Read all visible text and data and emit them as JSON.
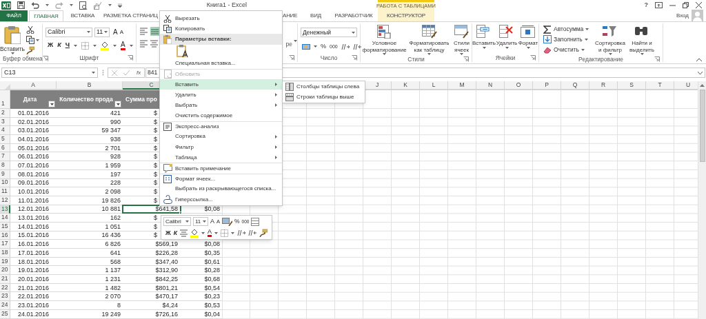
{
  "title_bar": {
    "title": "Книга1 - Excel",
    "help": "?",
    "contextual_group": "РАБОТА С ТАБЛИЦАМИ",
    "sign_in": "Вход"
  },
  "tabs": [
    {
      "label": "ФАЙЛ",
      "kind": "file",
      "selected": false
    },
    {
      "label": "ГЛАВНАЯ",
      "kind": "tab",
      "selected": true
    },
    {
      "label": "ВСТАВКА",
      "kind": "tab",
      "selected": false
    },
    {
      "label": "РАЗМЕТКА СТРАНИЦ",
      "kind": "tab",
      "selected": false
    },
    {
      "label": "АНИЕ",
      "kind": "tab",
      "selected": false
    },
    {
      "label": "ВИД",
      "kind": "tab",
      "selected": false
    },
    {
      "label": "РАЗРАБОТЧИК",
      "kind": "tab",
      "selected": false
    },
    {
      "label": "КОНСТРУКТОР",
      "kind": "contextual",
      "selected": false
    }
  ],
  "ribbon": {
    "groups": [
      {
        "kind": "clipboard",
        "label": "Буфер обмена",
        "paste": "Вставить"
      },
      {
        "kind": "font",
        "label": "Шрифт",
        "font": "Calibri",
        "size": "11",
        "grow": "A",
        "shrink": "A",
        "styles": [
          "Ж",
          "К",
          "Ч"
        ],
        "font_color": "A"
      },
      {
        "kind": "alignment",
        "fragment": "ре",
        "align_buttons": [
          {
            "selected": false
          },
          {
            "selected": true
          }
        ]
      },
      {
        "kind": "number",
        "label": "Число",
        "format": "Денежный",
        "percent": "%",
        "thousands": "000"
      },
      {
        "kind": "styles",
        "label": "Стили",
        "buttons": [
          {
            "label": "Условное форматирование"
          },
          {
            "label": "Форматировать как таблицу"
          },
          {
            "label": "Стили ячеек"
          }
        ]
      },
      {
        "kind": "cells",
        "label": "Ячейки",
        "buttons": [
          {
            "label": "Вставить"
          },
          {
            "label": "Удалить"
          },
          {
            "label": "Формат"
          }
        ]
      },
      {
        "kind": "editing",
        "label": "Редактирование",
        "small_buttons": [
          {
            "label": "Автосумма"
          },
          {
            "label": "Заполнить"
          },
          {
            "label": "Очистить"
          }
        ],
        "buttons": [
          {
            "label": "Сортировка и фильтр"
          },
          {
            "label": "Найти и выделить"
          }
        ]
      }
    ]
  },
  "formula_bar": {
    "name_box": "C13",
    "fx": "fx",
    "value": "841"
  },
  "sheet": {
    "column_headers": [
      {
        "label": "A",
        "selected": false
      },
      {
        "label": "B",
        "selected": false
      },
      {
        "label": "C",
        "selected": true
      },
      {
        "label": "J",
        "selected": false
      },
      {
        "label": "K",
        "selected": false
      },
      {
        "label": "L",
        "selected": false
      },
      {
        "label": "M",
        "selected": false
      },
      {
        "label": "N",
        "selected": false
      },
      {
        "label": "O",
        "selected": false
      },
      {
        "label": "P",
        "selected": false
      },
      {
        "label": "Q",
        "selected": false
      },
      {
        "label": "R",
        "selected": false
      },
      {
        "label": "S",
        "selected": false
      },
      {
        "label": "T",
        "selected": false
      },
      {
        "label": "U",
        "selected": false
      }
    ],
    "header_row": {
      "n": "1",
      "cells": [
        {
          "label": "Дата",
          "filter": true
        },
        {
          "label": "Количество прода",
          "filter": true
        },
        {
          "label": "Сумма про",
          "filter": false
        }
      ]
    },
    "rows": [
      {
        "n": "2",
        "selected": false,
        "date": "01.01.2016",
        "qty": "421",
        "sum": "$",
        "sum_cut": true
      },
      {
        "n": "3",
        "selected": false,
        "date": "02.01.2016",
        "qty": "990",
        "sum": "$",
        "sum_cut": true
      },
      {
        "n": "4",
        "selected": false,
        "date": "03.01.2016",
        "qty": "59 347",
        "sum": "$",
        "sum_cut": true
      },
      {
        "n": "5",
        "selected": false,
        "date": "04.01.2016",
        "qty": "938",
        "sum": "$",
        "sum_cut": true
      },
      {
        "n": "6",
        "selected": false,
        "date": "05.01.2016",
        "qty": "2 701",
        "sum": "$",
        "sum_cut": true
      },
      {
        "n": "7",
        "selected": false,
        "date": "06.01.2016",
        "qty": "928",
        "sum": "$",
        "sum_cut": true
      },
      {
        "n": "8",
        "selected": false,
        "date": "07.01.2016",
        "qty": "1 959",
        "sum": "$",
        "sum_cut": true
      },
      {
        "n": "9",
        "selected": false,
        "date": "08.01.2016",
        "qty": "197",
        "sum": "$",
        "sum_cut": true
      },
      {
        "n": "10",
        "selected": false,
        "date": "09.01.2016",
        "qty": "228",
        "sum": "$",
        "sum_cut": true
      },
      {
        "n": "11",
        "selected": false,
        "date": "10.01.2016",
        "qty": "2 098",
        "sum": "$",
        "sum_cut": true
      },
      {
        "n": "12",
        "selected": false,
        "date": "11.01.2016",
        "qty": "19 826",
        "sum": "$",
        "sum_cut": true
      },
      {
        "n": "13",
        "selected": true,
        "date": "12.01.2016",
        "qty": "10 881",
        "sum": "$641,58",
        "sum_cut": false,
        "share": "$0,08"
      },
      {
        "n": "14",
        "selected": false,
        "date": "13.01.2016",
        "qty": "162",
        "sum": "$",
        "sum_cut": true
      },
      {
        "n": "15",
        "selected": false,
        "date": "14.01.2016",
        "qty": "1 051",
        "sum": "$",
        "sum_cut": true
      },
      {
        "n": "16",
        "selected": false,
        "date": "15.01.2016",
        "qty": "16 436",
        "sum": "$",
        "sum_cut": true
      },
      {
        "n": "17",
        "selected": false,
        "date": "16.01.2016",
        "qty": "6 826",
        "sum": "$569,19",
        "sum_cut": false,
        "share": "$0,08"
      },
      {
        "n": "18",
        "selected": false,
        "date": "17.01.2016",
        "qty": "641",
        "sum": "$226,28",
        "sum_cut": false,
        "share": "$0,35"
      },
      {
        "n": "19",
        "selected": false,
        "date": "18.01.2016",
        "qty": "568",
        "sum": "$347,40",
        "sum_cut": false,
        "share": "$0,61"
      },
      {
        "n": "20",
        "selected": false,
        "date": "19.01.2016",
        "qty": "1 137",
        "sum": "$312,90",
        "sum_cut": false,
        "share": "$0,28"
      },
      {
        "n": "21",
        "selected": false,
        "date": "20.01.2016",
        "qty": "1 231",
        "sum": "$842,25",
        "sum_cut": false,
        "share": "$0,68"
      },
      {
        "n": "22",
        "selected": false,
        "date": "21.01.2016",
        "qty": "1 482",
        "sum": "$801,21",
        "sum_cut": false,
        "share": "$0,54"
      },
      {
        "n": "23",
        "selected": false,
        "date": "22.01.2016",
        "qty": "2 070",
        "sum": "$470,17",
        "sum_cut": false,
        "share": "$0,23"
      },
      {
        "n": "24",
        "selected": false,
        "date": "23.01.2016",
        "qty": "8",
        "sum": "$4,24",
        "sum_cut": false,
        "share": "$0,53"
      },
      {
        "n": "25",
        "selected": false,
        "date": "24.01.2016",
        "qty": "19 249",
        "sum": "$726,16",
        "sum_cut": false,
        "share": "$0,04"
      }
    ]
  },
  "context_menu": {
    "items": [
      {
        "kind": "item",
        "label": "Вырезать",
        "disabled": false,
        "selected": false,
        "submenu": false,
        "separator_before": false
      },
      {
        "kind": "item",
        "label": "Копировать",
        "disabled": false,
        "selected": false,
        "submenu": false,
        "separator_before": false
      },
      {
        "kind": "header",
        "label": "Параметры вставки:"
      },
      {
        "kind": "paste-options"
      },
      {
        "kind": "item",
        "label": "Специальная вставка...",
        "disabled": false,
        "selected": false,
        "submenu": false,
        "separator_before": false
      },
      {
        "kind": "item",
        "label": "Обновить",
        "disabled": true,
        "selected": false,
        "submenu": false,
        "separator_before": true
      },
      {
        "kind": "item",
        "label": "Вставить",
        "disabled": false,
        "selected": true,
        "submenu": true,
        "separator_before": false
      },
      {
        "kind": "item",
        "label": "Удалить",
        "disabled": false,
        "selected": false,
        "submenu": true,
        "separator_before": false
      },
      {
        "kind": "item",
        "label": "Выбрать",
        "disabled": false,
        "selected": false,
        "submenu": true,
        "separator_before": false
      },
      {
        "kind": "item",
        "label": "Очистить содержимое",
        "disabled": false,
        "selected": false,
        "submenu": false,
        "separator_before": false
      },
      {
        "kind": "item",
        "label": "Экспресс-анализ",
        "disabled": false,
        "selected": false,
        "submenu": false,
        "separator_before": true
      },
      {
        "kind": "item",
        "label": "Сортировка",
        "disabled": false,
        "selected": false,
        "submenu": true,
        "separator_before": false
      },
      {
        "kind": "item",
        "label": "Фильтр",
        "disabled": false,
        "selected": false,
        "submenu": true,
        "separator_before": false
      },
      {
        "kind": "item",
        "label": "Таблица",
        "disabled": false,
        "selected": false,
        "submenu": true,
        "separator_before": false
      },
      {
        "kind": "item",
        "label": "Вставить примечание",
        "disabled": false,
        "selected": false,
        "submenu": false,
        "separator_before": true
      },
      {
        "kind": "item",
        "label": "Формат ячеек...",
        "disabled": false,
        "selected": false,
        "submenu": false,
        "separator_before": true
      },
      {
        "kind": "item",
        "label": "Выбрать из раскрывающегося списка...",
        "disabled": false,
        "selected": false,
        "submenu": false,
        "separator_before": false
      },
      {
        "kind": "item",
        "label": "Гиперссылка...",
        "disabled": false,
        "selected": false,
        "submenu": false,
        "separator_before": false
      }
    ],
    "submenu": [
      {
        "label": "Столбцы таблицы слева"
      },
      {
        "label": "Строки таблицы выше"
      }
    ]
  },
  "mini_toolbar": {
    "font": "Calibri",
    "size": "11",
    "grow": "A",
    "shrink": "A",
    "percent": "%",
    "thousands": "000",
    "styles": [
      "Ж",
      "К"
    ],
    "font_color": "A"
  }
}
